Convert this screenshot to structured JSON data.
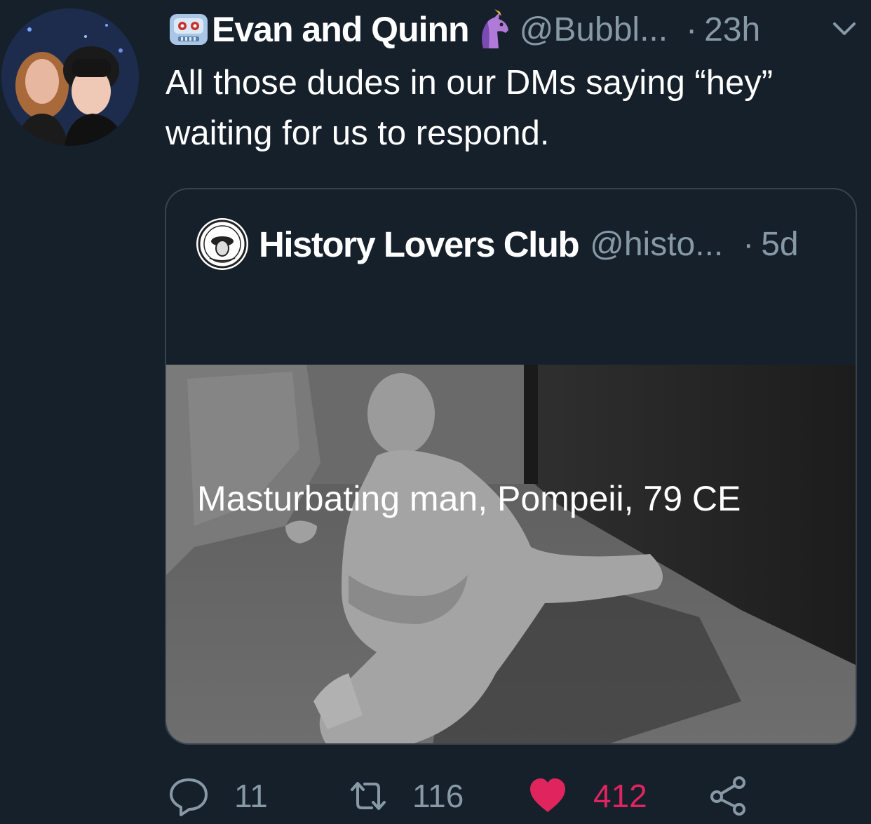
{
  "tweet": {
    "display_name": "Evan and Quinn",
    "name_emoji_left": "robot-emoji",
    "name_emoji_right": "unicorn-emoji",
    "handle": "@Bubbl...",
    "separator": "·",
    "time": "23h",
    "text": "All those dudes in our DMs saying “hey”\nwaiting for us to respond.",
    "menu_icon": "chevron-down-icon"
  },
  "quoted": {
    "display_name": "History Lovers Club",
    "handle": "@histo...",
    "separator": "·",
    "time": "5d",
    "text": "Masturbating man, Pompeii, 79 CE",
    "image_icon": "photo-of-plaster-cast"
  },
  "actions": {
    "reply_icon": "reply-icon",
    "reply_count": "11",
    "retweet_icon": "retweet-icon",
    "retweet_count": "116",
    "like_icon": "heart-icon",
    "like_count": "412",
    "share_icon": "share-icon"
  },
  "colors": {
    "background": "#15202b",
    "secondary_text": "#8899a6",
    "border": "#38444d",
    "like": "#e0245e"
  }
}
